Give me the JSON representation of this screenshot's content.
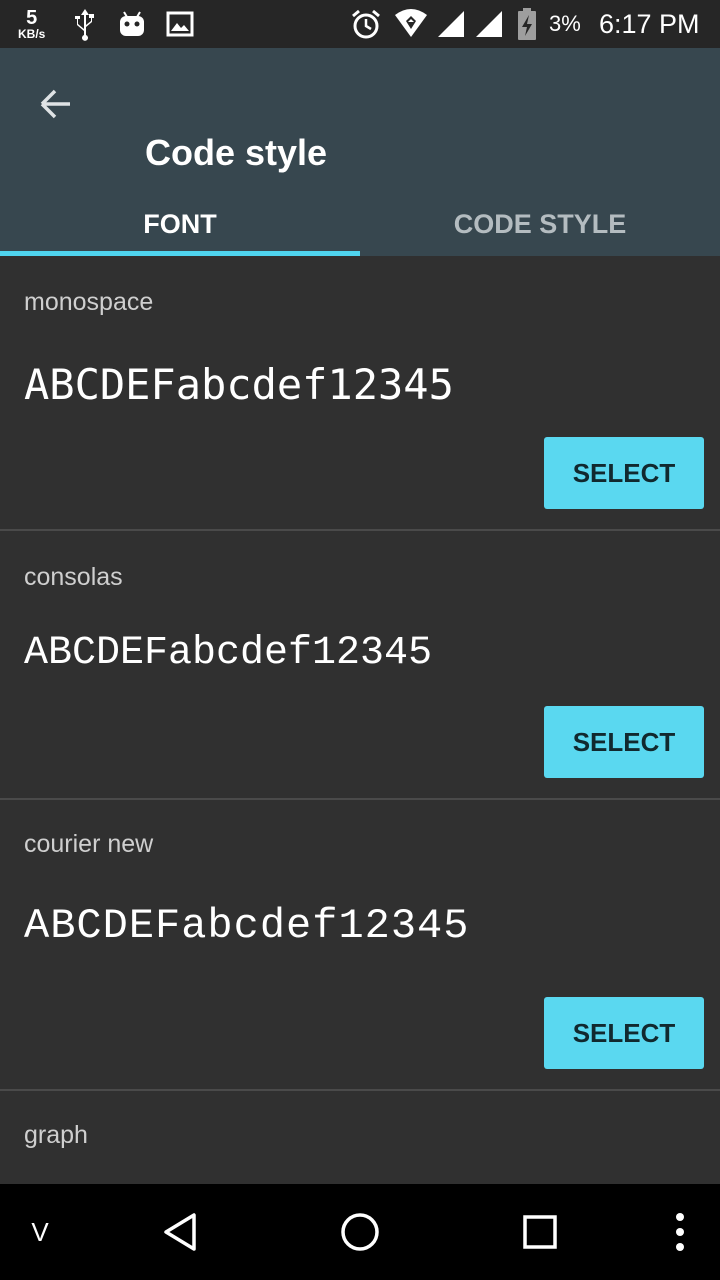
{
  "status_bar": {
    "speed_value": "5",
    "speed_unit": "KB/s",
    "battery_percent": "3%",
    "time": "6:17 PM",
    "icons": [
      "usb-icon",
      "android-icon",
      "image-icon",
      "alarm-icon",
      "wifi-icon",
      "signal-icon",
      "signal-icon",
      "battery-charging-icon"
    ]
  },
  "app_bar": {
    "title": "Code style",
    "back_icon": "arrow-left-icon"
  },
  "tabs": [
    {
      "label": "FONT",
      "selected": true
    },
    {
      "label": "CODE STYLE",
      "selected": false
    }
  ],
  "fonts": [
    {
      "name": "monospace",
      "sample": "ABCDEFabcdef12345",
      "button": "SELECT"
    },
    {
      "name": "consolas",
      "sample": "ABCDEFabcdef12345",
      "button": "SELECT"
    },
    {
      "name": "courier new",
      "sample": "ABCDEFabcdef12345",
      "button": "SELECT"
    },
    {
      "name": "graph"
    }
  ],
  "nav_bar": {
    "left_label": "V",
    "icons": [
      "back-icon",
      "home-icon",
      "recents-icon",
      "more-icon"
    ]
  },
  "colors": {
    "accent": "#5ad8f0",
    "app_bar": "#37474f",
    "background": "#303030"
  }
}
